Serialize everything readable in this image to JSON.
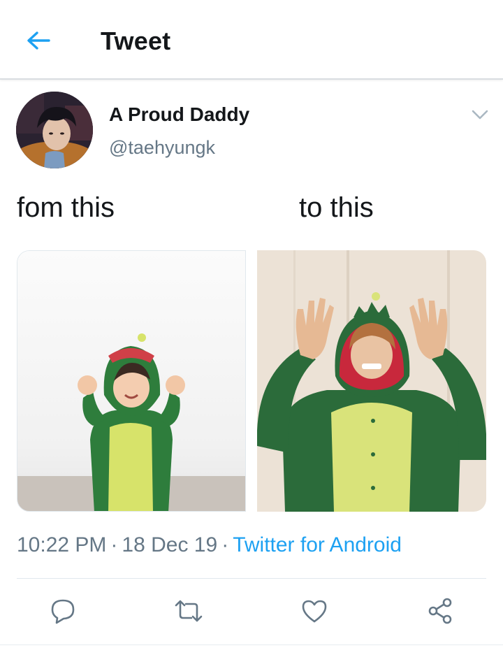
{
  "header": {
    "title": "Tweet"
  },
  "tweet": {
    "display_name": "A Proud Daddy",
    "handle": "@taehyungk",
    "text_left": "fom this",
    "text_right": "to this",
    "time": "10:22 PM",
    "date": "18 Dec 19",
    "separator": "·",
    "source": "Twitter for Android"
  },
  "icons": {
    "back": "arrow-left-icon",
    "caret": "chevron-down-icon",
    "reply": "reply-icon",
    "retweet": "retweet-icon",
    "like": "heart-icon",
    "share": "share-icon"
  },
  "colors": {
    "accent": "#1da1f2",
    "secondary_text": "#657786",
    "primary_text": "#14171a",
    "divider": "#e1e8ed"
  }
}
